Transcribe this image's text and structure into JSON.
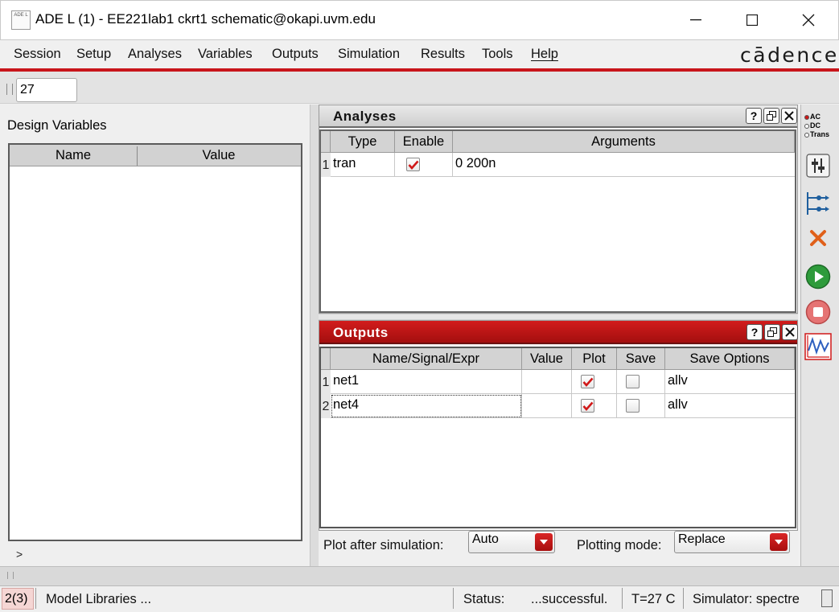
{
  "window": {
    "title": "ADE L (1) - EE221lab1 ckrt1 schematic@okapi.uvm.edu",
    "icon_text": "ADE L"
  },
  "menu": {
    "items": [
      "Session",
      "Setup",
      "Analyses",
      "Variables",
      "Outputs",
      "Simulation",
      "Results",
      "Tools",
      "Help"
    ],
    "brand": "cādence"
  },
  "toolbar": {
    "temperature_value": "27"
  },
  "design_variables": {
    "title": "Design Variables",
    "columns": [
      "Name",
      "Value"
    ],
    "prompt": ">"
  },
  "analyses": {
    "title": "Analyses",
    "columns": [
      "Type",
      "Enable",
      "Arguments"
    ],
    "rows": [
      {
        "index": "1",
        "type": "tran",
        "enabled": true,
        "arguments": "0 200n"
      }
    ]
  },
  "outputs": {
    "title": "Outputs",
    "columns": [
      "Name/Signal/Expr",
      "Value",
      "Plot",
      "Save",
      "Save Options"
    ],
    "rows": [
      {
        "index": "1",
        "name": "net1",
        "value": "",
        "plot": true,
        "save": false,
        "save_options": "allv"
      },
      {
        "index": "2",
        "name": "net4",
        "value": "",
        "plot": true,
        "save": false,
        "save_options": "allv"
      }
    ]
  },
  "plot_controls": {
    "plot_after_label": "Plot after simulation:",
    "plot_after_value": "Auto",
    "plotting_mode_label": "Plotting mode:",
    "plotting_mode_value": "Replace"
  },
  "right_tools": {
    "analysis_radio": [
      "AC",
      "DC",
      "Trans"
    ]
  },
  "statusbar": {
    "index": "2(3)",
    "model_libraries": "Model Libraries ...",
    "status_label": "Status:",
    "status_value": "...successful.",
    "temperature": "T=27 C",
    "simulator": "Simulator: spectre"
  },
  "colors": {
    "accent_red": "#c8151b",
    "check_red": "#d01818",
    "run_green": "#2e9b3b"
  }
}
